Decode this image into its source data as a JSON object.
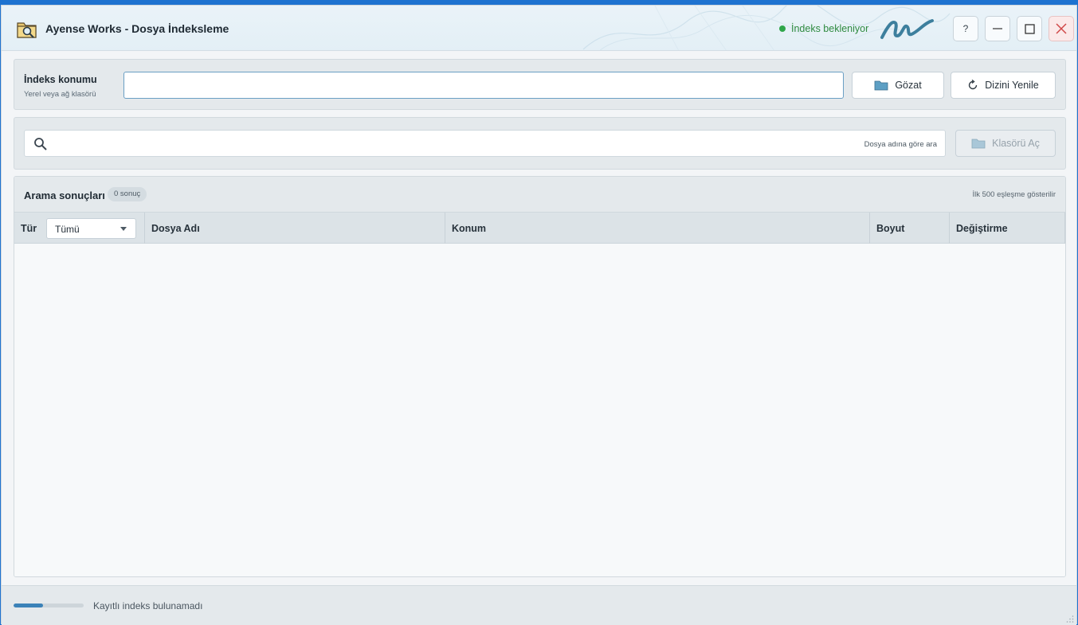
{
  "window": {
    "title": "Ayense Works - Dosya İndeksleme",
    "status": "İndeks bekleniyor",
    "help_label": "?",
    "brand_color": "#3b82b8"
  },
  "index_panel": {
    "title": "İndeks konumu",
    "subtitle": "Yerel veya ağ klasörü",
    "path_value": "",
    "browse_label": "Gözat",
    "refresh_label": "Dizini Yenile"
  },
  "search_panel": {
    "query": "",
    "hint": "Dosya adına göre ara",
    "open_folder_label": "Klasörü Aç"
  },
  "results": {
    "title": "Arama sonuçları",
    "count": "0 sonuç",
    "limit_note": "İlk 500 eşleşme gösterilir",
    "columns": {
      "type": "Tür",
      "name": "Dosya Adı",
      "location": "Konum",
      "size": "Boyut",
      "modified": "Değiştirme"
    },
    "type_filter": "Tümü",
    "rows": []
  },
  "statusbar": {
    "progress_percent": 42,
    "text": "Kayıtlı indeks bulunamadı"
  }
}
